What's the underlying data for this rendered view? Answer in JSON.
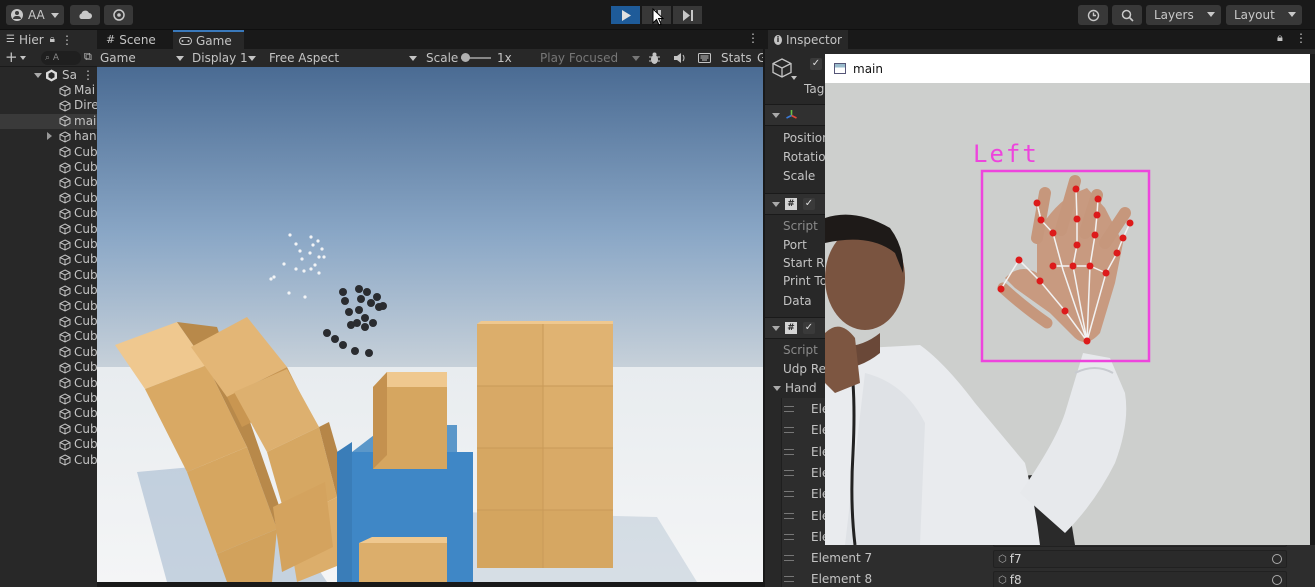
{
  "toolbar": {
    "account_label": "AA",
    "layers_label": "Layers",
    "layout_label": "Layout",
    "icons": [
      "account-icon",
      "cloud-icon",
      "collab-icon",
      "play-icon",
      "pause-icon",
      "step-icon",
      "history-icon",
      "search-icon"
    ]
  },
  "hierarchy": {
    "tab_label": "Hier",
    "search_placeholder": "A",
    "scene_name": "Sa",
    "items": [
      {
        "label": "Mai"
      },
      {
        "label": "Dire"
      },
      {
        "label": "mai"
      },
      {
        "label": "han"
      },
      {
        "label": "Cub"
      },
      {
        "label": "Cub"
      },
      {
        "label": "Cub"
      },
      {
        "label": "Cub"
      },
      {
        "label": "Cub"
      },
      {
        "label": "Cub"
      },
      {
        "label": "Cub"
      },
      {
        "label": "Cub"
      },
      {
        "label": "Cub"
      },
      {
        "label": "Cub"
      },
      {
        "label": "Cub"
      },
      {
        "label": "Cub"
      },
      {
        "label": "Cub"
      },
      {
        "label": "Cub"
      },
      {
        "label": "Cub"
      },
      {
        "label": "Cub"
      },
      {
        "label": "Cub"
      },
      {
        "label": "Cub"
      },
      {
        "label": "Cub"
      },
      {
        "label": "Cub"
      },
      {
        "label": "Cub"
      }
    ]
  },
  "center_tabs": {
    "scene": "Scene",
    "game": "Game"
  },
  "game_toolbar": {
    "mode": "Game",
    "display": "Display 1",
    "aspect": "Free Aspect",
    "scale_label": "Scale",
    "scale_value": "1x",
    "play_mode": "Play Focused",
    "stats": "Stats",
    "gizmos": "G"
  },
  "inspector": {
    "tab_label": "Inspector",
    "tag_label": "Tag",
    "transform": {
      "position": "Position",
      "rotation": "Rotation",
      "scale": "Scale"
    },
    "component1": {
      "script": "Script",
      "port": "Port",
      "start_r": "Start R",
      "print_t": "Print To",
      "data": "Data"
    },
    "component2": {
      "script": "Script",
      "udp_re": "Udp Re",
      "hand": "Hand"
    },
    "elements": [
      {
        "label": "Ele",
        "value": ""
      },
      {
        "label": "Ele",
        "value": ""
      },
      {
        "label": "Ele",
        "value": ""
      },
      {
        "label": "Ele",
        "value": ""
      },
      {
        "label": "Ele",
        "value": ""
      },
      {
        "label": "Ele",
        "value": ""
      },
      {
        "label": "Ele",
        "value": ""
      },
      {
        "label": "Element 7",
        "value": "f7"
      },
      {
        "label": "Element 8",
        "value": "f8"
      }
    ]
  },
  "camera_window": {
    "title": "main",
    "hand_label": "Left"
  }
}
